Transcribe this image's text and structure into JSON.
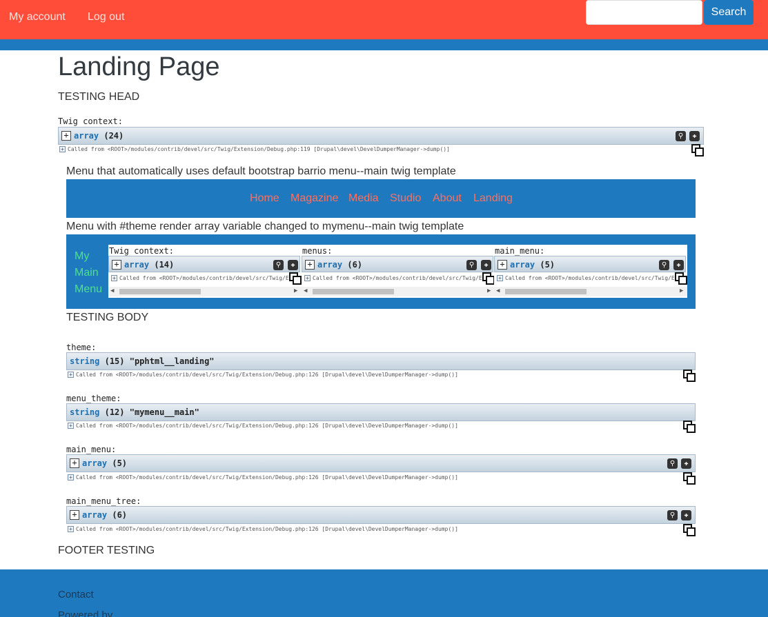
{
  "topbar": {
    "my_account": "My account",
    "log_out": "Log out",
    "search_value": "",
    "search_button": "Search"
  },
  "page": {
    "title": "Landing Page",
    "testing_head": "TESTING HEAD",
    "twig_context_label": "Twig context:",
    "top_dump": {
      "type": "array",
      "count": "(24)",
      "called": "Called from <ROOT>/modules/contrib/devel/src/Twig/Extension/Debug.php:119 [Drupal\\devel\\DevelDumperManager->dump()]"
    },
    "menu1_caption": "Menu that automatically uses default bootstrap barrio menu--main twig template",
    "menu1_items": [
      "Home",
      "Magazine",
      "Media",
      "Studio",
      "About",
      "Landing"
    ],
    "menu2_caption": "Menu with #theme render array variable changed to mymenu--main twig template",
    "menu2": {
      "title_lines": [
        "My",
        "Main",
        "Menu"
      ],
      "panels": [
        {
          "label": "Twig context:",
          "type": "array",
          "count": "(14)",
          "called": "Called from <ROOT>/modules/contrib/devel/src/Twig/Exte"
        },
        {
          "label": "menus:",
          "type": "array",
          "count": "(6)",
          "called": "Called from <ROOT>/modules/contrib/devel/src/Twig/Exte"
        },
        {
          "label": "main_menu:",
          "type": "array",
          "count": "(5)",
          "called": "Called from <ROOT>/modules/contrib/devel/src/Twig/Exte"
        }
      ]
    },
    "testing_body": "TESTING BODY",
    "dumps": [
      {
        "label": "theme:",
        "type": "string",
        "rest": "(15) \"pphtml__landing\"",
        "called": "Called from <ROOT>/modules/contrib/devel/src/Twig/Extension/Debug.php:126 [Drupal\\devel\\DevelDumperManager->dump()]"
      },
      {
        "label": "menu_theme:",
        "type": "string",
        "rest": "(12) \"mymenu__main\"",
        "called": "Called from <ROOT>/modules/contrib/devel/src/Twig/Extension/Debug.php:126 [Drupal\\devel\\DevelDumperManager->dump()]"
      },
      {
        "label": "main_menu:",
        "type": "array",
        "rest": "(5)",
        "called": "Called from <ROOT>/modules/contrib/devel/src/Twig/Extension/Debug.php:126 [Drupal\\devel\\DevelDumperManager->dump()]"
      },
      {
        "label": "main_menu_tree:",
        "type": "array",
        "rest": "(6)",
        "called": "Called from <ROOT>/modules/contrib/devel/src/Twig/Extension/Debug.php:126 [Drupal\\devel\\DevelDumperManager->dump()]"
      }
    ],
    "footer_testing": "FOOTER TESTING"
  },
  "footer": {
    "contact": "Contact",
    "powered_by": "Powered by"
  },
  "colors": {
    "topbar": "#ff4d3a",
    "brand_blue": "#1f79be",
    "menu_link": "#ff6f5e",
    "mymenu_text": "#4ee08a"
  },
  "icons": [
    "search-zoom-icon",
    "expand-all-icon",
    "duplicate-icon",
    "expand-toggle-icon"
  ]
}
